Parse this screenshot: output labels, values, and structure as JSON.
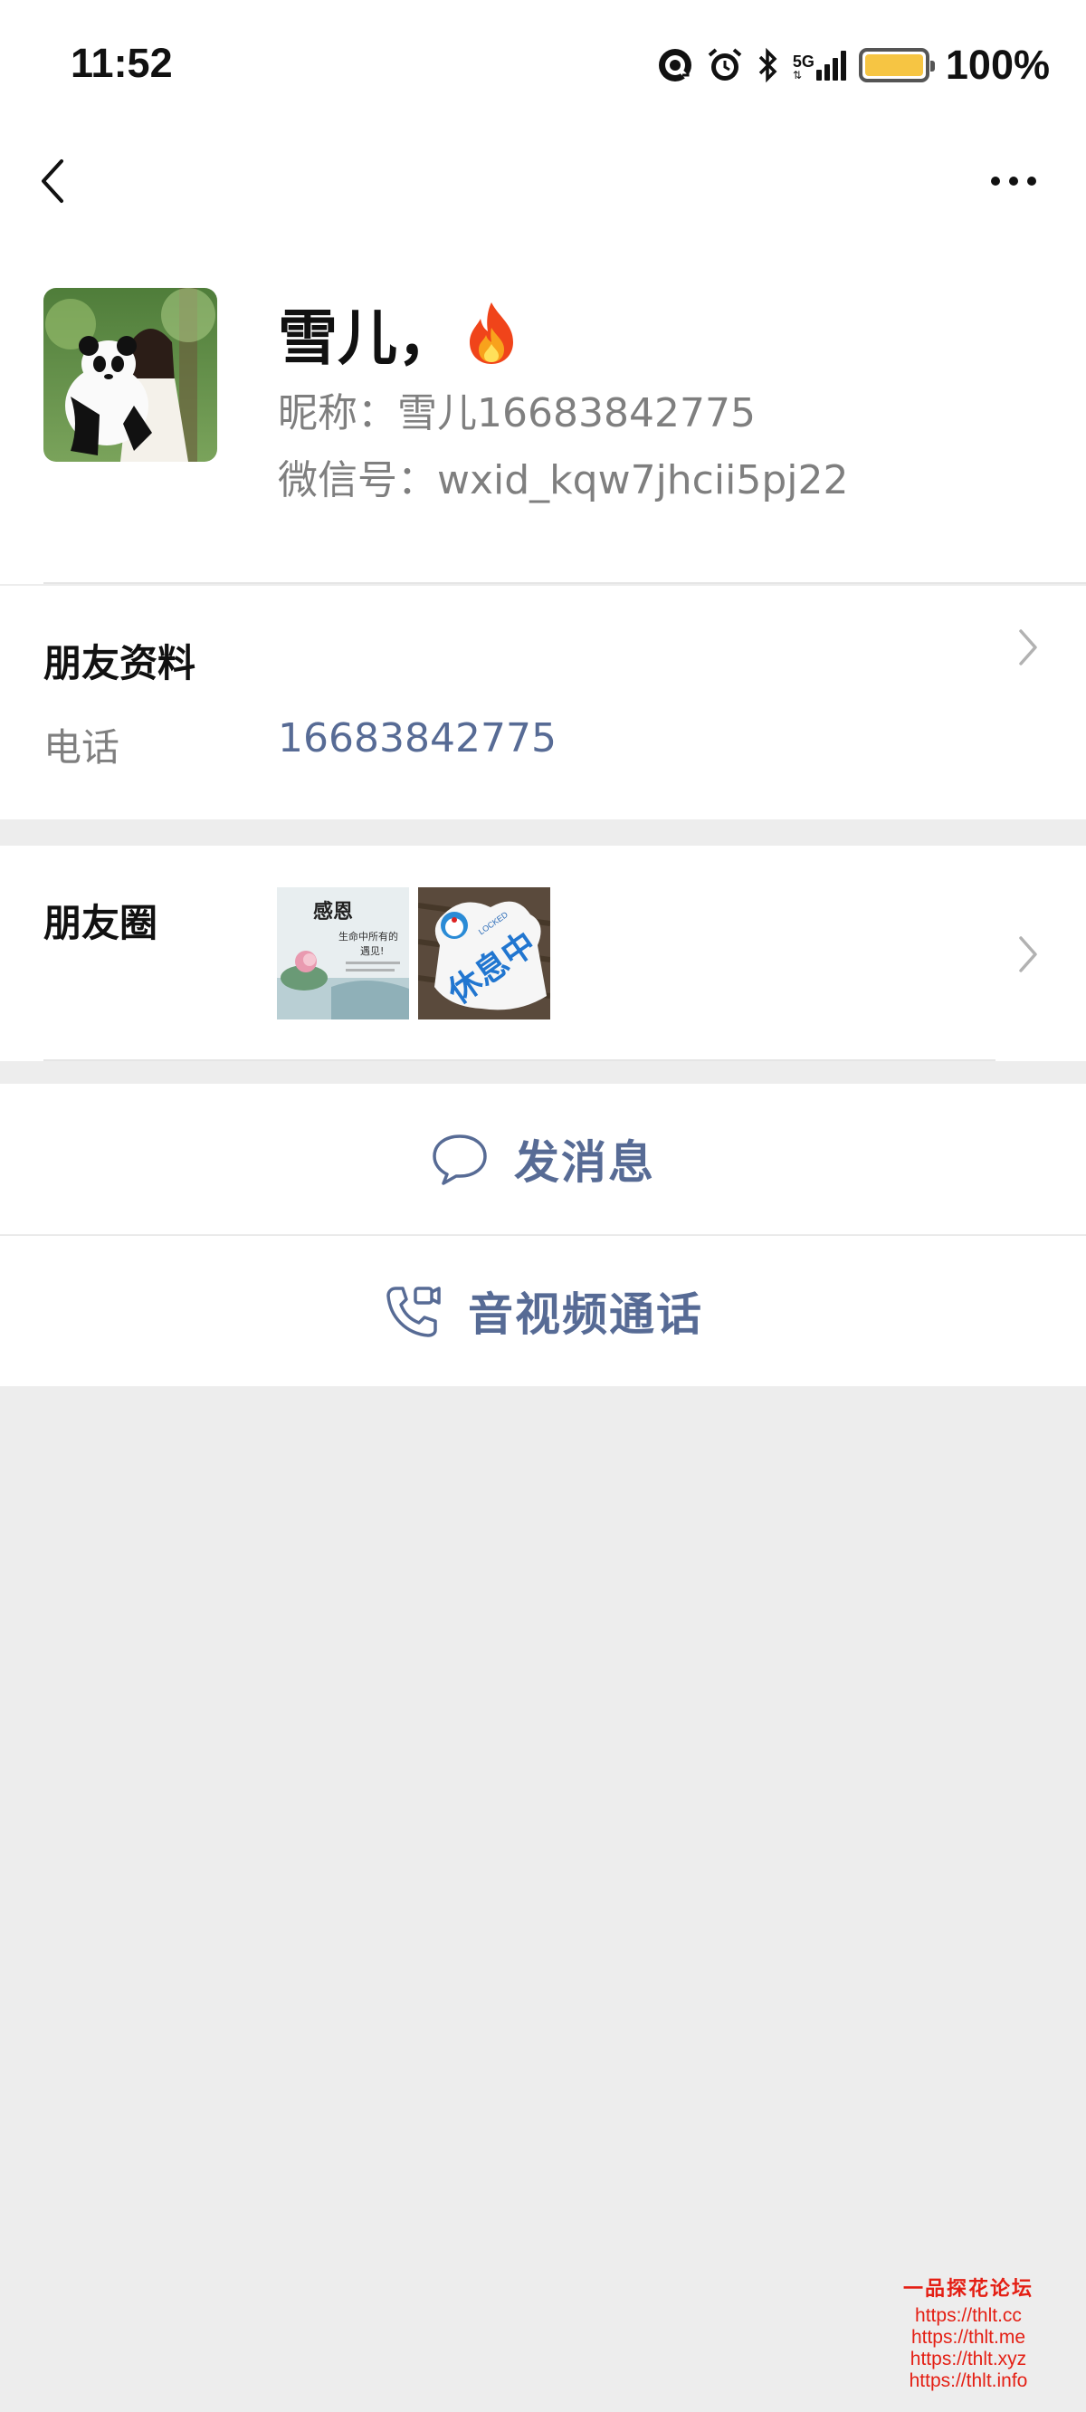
{
  "status_bar": {
    "time": "11:52",
    "network": "5G",
    "battery": "100%",
    "battery_level": 1.0,
    "icons": [
      "hotspot-icon",
      "alarm-icon",
      "bluetooth-icon",
      "signal-icon",
      "battery-icon"
    ]
  },
  "nav": {
    "back_icon": "chevron-left-icon",
    "more_icon": "ellipsis-icon"
  },
  "profile": {
    "name": "雪儿，",
    "badge_emoji": "🔥",
    "nickname": "昵称：雪儿16683842775",
    "wechat_id": "微信号：wxid_kqw7jhcii5pj22"
  },
  "friend_info": {
    "title": "朋友资料",
    "phone_label": "电话",
    "phone_value": "16683842775"
  },
  "moments": {
    "title": "朋友圈",
    "thumb1": {
      "title": "感恩",
      "lines": [
        "生命中所有的",
        "遇见!"
      ]
    },
    "thumb2": {
      "text": "休息中",
      "small": "LOCKED"
    }
  },
  "actions": {
    "message": "发消息",
    "video_call": "音视频通话"
  },
  "watermark": {
    "title": "一品探花论坛",
    "links": [
      "https://thlt.cc",
      "https://thlt.me",
      "https://thlt.xyz",
      "https://thlt.info"
    ]
  },
  "colors": {
    "link": "#576b95",
    "background": "#ededed",
    "battery": "#f6c543",
    "watermark": "#e41f14"
  }
}
